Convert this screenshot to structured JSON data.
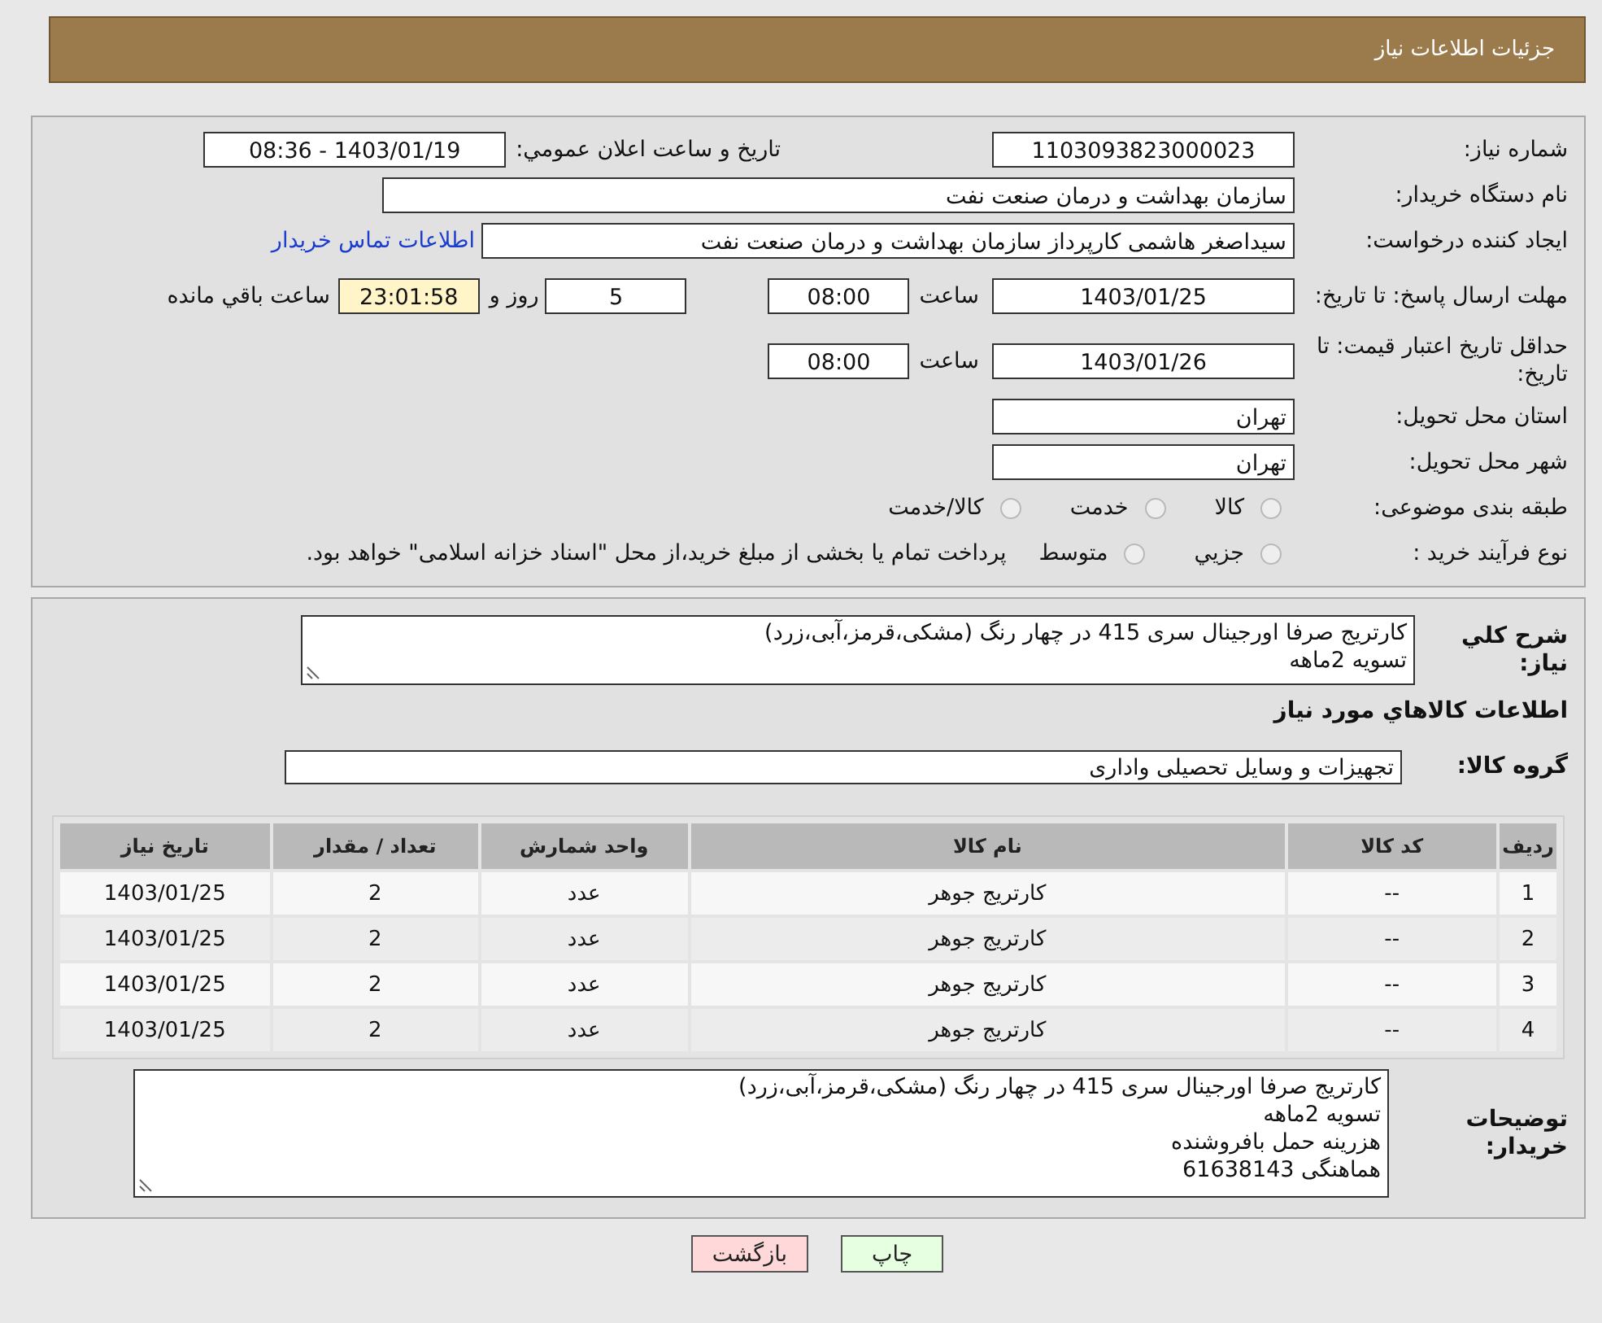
{
  "header": {
    "title": "جزئیات اطلاعات نیاز"
  },
  "need_number": {
    "label": "شماره نیاز:",
    "value": "1103093823000023"
  },
  "announce": {
    "label": "تاریخ و ساعت اعلان عمومي:",
    "value": "1403/01/19 - 08:36"
  },
  "buyer": {
    "label": "نام دستگاه خریدار:",
    "value": "سازمان بهداشت و درمان صنعت نفت"
  },
  "requester": {
    "label": "ایجاد کننده درخواست:",
    "value": "سیداصغر هاشمی کارپرداز سازمان بهداشت و درمان صنعت نفت",
    "link": "اطلاعات تماس خریدار"
  },
  "deadline": {
    "label": "مهلت ارسال پاسخ: تا تاریخ:",
    "date": "1403/01/25",
    "time_label": "ساعت",
    "time": "08:00",
    "days": "5",
    "days_label": "روز و",
    "remaining": "23:01:58",
    "remaining_label": "ساعت باقي مانده"
  },
  "validity": {
    "label": "حداقل تاریخ اعتبار قیمت: تا تاریخ:",
    "date": "1403/01/26",
    "time_label": "ساعت",
    "time": "08:00"
  },
  "province": {
    "label": "استان محل تحویل:",
    "value": "تهران"
  },
  "city": {
    "label": "شهر محل تحویل:",
    "value": "تهران"
  },
  "category": {
    "label": "طبقه بندی موضوعی:",
    "options": [
      {
        "label": "کالا",
        "selected": false
      },
      {
        "label": "خدمت",
        "selected": false
      },
      {
        "label": "کالا/خدمت",
        "selected": false
      }
    ]
  },
  "process": {
    "label": "نوع فرآیند خرید :",
    "options": [
      {
        "label": "جزيي",
        "selected": false
      },
      {
        "label": "متوسط",
        "selected": false
      }
    ],
    "note": "پرداخت تمام یا بخشی از مبلغ خرید،از محل \"اسناد خزانه اسلامی\" خواهد بود."
  },
  "summary": {
    "label": "شرح کلي نياز:",
    "text": "کارتریج صرفا اورجینال سری 415 در چهار رنگ (مشکی،قرمز،آبی،زرد)\nتسویه 2ماهه"
  },
  "items_heading": "اطلاعات کالاهاي مورد نياز",
  "goods_group": {
    "label": "گروه کالا:",
    "value": "تجهیزات و وسایل تحصیلی واداری"
  },
  "table": {
    "columns": [
      "ردیف",
      "کد کالا",
      "نام کالا",
      "واحد شمارش",
      "تعداد / مقدار",
      "تاریخ نیاز"
    ],
    "rows": [
      [
        "1",
        "--",
        "کارتریج جوهر",
        "عدد",
        "2",
        "1403/01/25"
      ],
      [
        "2",
        "--",
        "کارتریج جوهر",
        "عدد",
        "2",
        "1403/01/25"
      ],
      [
        "3",
        "--",
        "کارتریج جوهر",
        "عدد",
        "2",
        "1403/01/25"
      ],
      [
        "4",
        "--",
        "کارتریج جوهر",
        "عدد",
        "2",
        "1403/01/25"
      ]
    ]
  },
  "buyer_notes": {
    "label": "توضیحات خریدار:",
    "text": "کارتریج صرفا اورجینال سری 415 در چهار رنگ (مشکی،قرمز،آبی،زرد)\nتسویه 2ماهه\nهزرینه حمل بافروشنده\nهماهنگی 61638143"
  },
  "buttons": [
    {
      "label": "چاپ",
      "kind": "print"
    },
    {
      "label": "بازگشت",
      "kind": "back"
    }
  ]
}
